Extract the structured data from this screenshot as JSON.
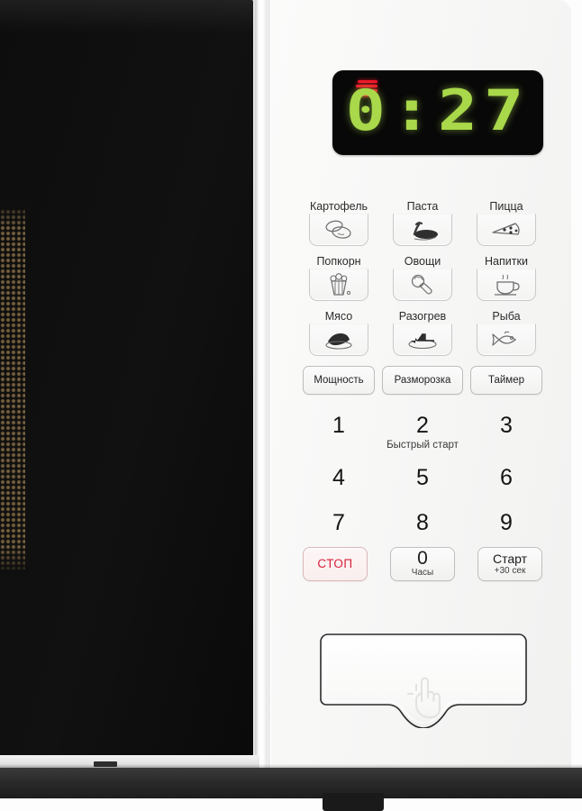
{
  "device": {
    "type": "microwave-oven",
    "panel_color": "#f7f7f6",
    "door_color": "#0d0d0d"
  },
  "display": {
    "time": "0:27",
    "indicator": "microwave-waves",
    "indicator_color": "#f2182b",
    "digit_color": "#a9d84a",
    "background_color": "#080808"
  },
  "presets": {
    "rows": [
      [
        {
          "label": "Картофель",
          "icon": "potato-icon"
        },
        {
          "label": "Паста",
          "icon": "pasta-icon"
        },
        {
          "label": "Пицца",
          "icon": "pizza-icon"
        }
      ],
      [
        {
          "label": "Попкорн",
          "icon": "popcorn-icon"
        },
        {
          "label": "Овощи",
          "icon": "vegetables-icon"
        },
        {
          "label": "Напитки",
          "icon": "beverage-cup-icon"
        }
      ],
      [
        {
          "label": "Мясо",
          "icon": "meat-icon"
        },
        {
          "label": "Разогрев",
          "icon": "reheat-plate-icon"
        },
        {
          "label": "Рыба",
          "icon": "fish-icon"
        }
      ]
    ]
  },
  "functions": [
    {
      "label": "Мощность"
    },
    {
      "label": "Разморозка"
    },
    {
      "label": "Таймер"
    }
  ],
  "keypad": {
    "rows": [
      [
        "1",
        "2",
        "3"
      ],
      [
        "4",
        "5",
        "6"
      ],
      [
        "7",
        "8",
        "9"
      ]
    ],
    "quick_start_label": "Быстрый старт"
  },
  "bottom_controls": {
    "stop": {
      "label": "СТОП",
      "color": "#d8203a"
    },
    "zero": {
      "label": "0",
      "sub_label": "Часы"
    },
    "start": {
      "label": "Старт",
      "sub_label": "+30 сек"
    }
  },
  "door": {
    "open_button_icon": "hand-press-icon",
    "mesh": "perforated-screen"
  }
}
